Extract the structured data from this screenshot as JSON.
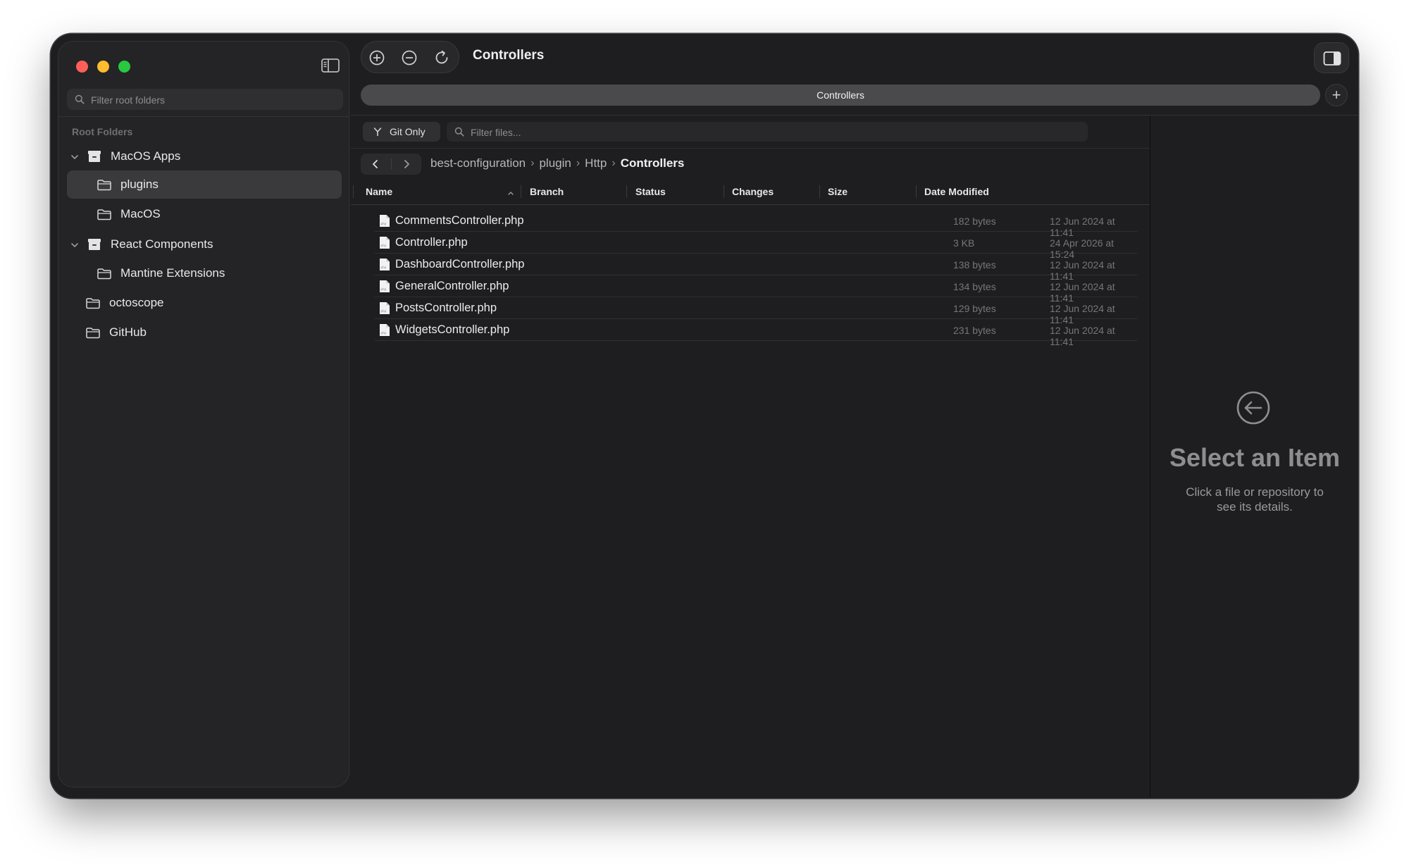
{
  "window": {
    "title": "Controllers"
  },
  "sidebar": {
    "search_placeholder": "Filter root folders",
    "section_label": "Root Folders",
    "items": [
      {
        "label": "MacOS Apps",
        "icon": "archive-box-icon"
      },
      {
        "label": "plugins",
        "icon": "folder-icon"
      },
      {
        "label": "MacOS",
        "icon": "folder-icon"
      },
      {
        "label": "React Components",
        "icon": "archive-box-icon"
      },
      {
        "label": "Mantine Extensions",
        "icon": "folder-icon"
      },
      {
        "label": "octoscope",
        "icon": "folder-icon"
      },
      {
        "label": "GitHub",
        "icon": "folder-icon"
      }
    ]
  },
  "tabs": [
    {
      "label": "Controllers",
      "active": true
    }
  ],
  "toolbar": {
    "git_only_label": "Git Only",
    "filter_placeholder": "Filter files..."
  },
  "breadcrumb": {
    "parts": [
      "best-configuration",
      "plugin",
      "Http"
    ],
    "current": "Controllers"
  },
  "table": {
    "columns": [
      "Name",
      "Branch",
      "Status",
      "Changes",
      "Size",
      "Date Modified"
    ],
    "sort_column": "Name",
    "rows": [
      {
        "name": "CommentsController.php",
        "size": "182 bytes",
        "date": "12 Jun 2024 at 11:41"
      },
      {
        "name": "Controller.php",
        "size": "3 KB",
        "date": "24 Apr 2026 at 15:24"
      },
      {
        "name": "DashboardController.php",
        "size": "138 bytes",
        "date": "12 Jun 2024 at 11:41"
      },
      {
        "name": "GeneralController.php",
        "size": "134 bytes",
        "date": "12 Jun 2024 at 11:41"
      },
      {
        "name": "PostsController.php",
        "size": "129 bytes",
        "date": "12 Jun 2024 at 11:41"
      },
      {
        "name": "WidgetsController.php",
        "size": "231 bytes",
        "date": "12 Jun 2024 at 11:41"
      }
    ]
  },
  "inspector": {
    "title": "Select an Item",
    "description": "Click a file or repository to see its details."
  },
  "colors": {
    "window_bg": "#1e1e20",
    "sidebar_bg": "#242426",
    "selected_bg": "#3a3a3d",
    "close": "#ff5f57",
    "minimize": "#febc2e",
    "zoom": "#28c840"
  }
}
